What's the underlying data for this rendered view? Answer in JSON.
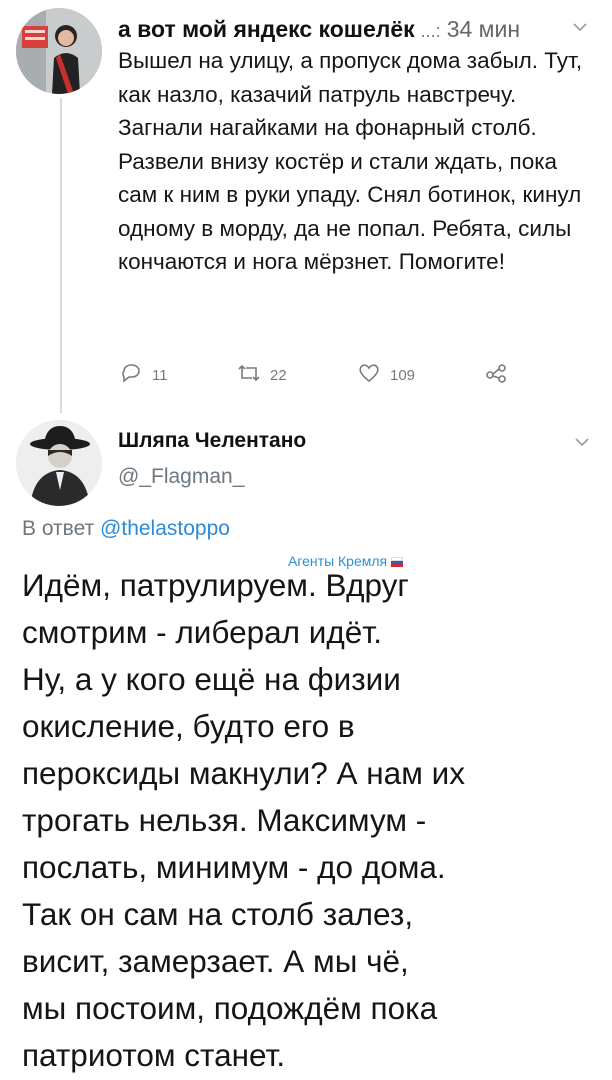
{
  "tweet1": {
    "author_name": "а вот мой яндекс кошелёк",
    "dots": "...:",
    "time": "34 мин",
    "text": "Вышел на улицу, а пропуск дома забыл. Тут, как назло, казачий патруль навстречу. Загнали нагайками на фонарный столб. Развели внизу костёр и стали ждать, пока сам к ним в руки упаду. Снял ботинок, кинул одному в морду, да не попал. Ребята, силы кончаются и нога мёрзнет. Помогите!",
    "reply_count": "11",
    "retweet_count": "22",
    "like_count": "109"
  },
  "tweet2": {
    "author_name": "Шляпа Челентано",
    "handle": "@_Flagman_",
    "reply_prefix": "В ответ",
    "reply_mention": "@thelastoppo",
    "badge_text": "Агенты Кремля",
    "lines": [
      "Идём, патрулируем. Вдруг",
      "смотрим - либерал идёт.",
      "Ну, а у кого ещё на физии",
      "окисление, будто его в",
      "пероксиды макнули? А нам их",
      "трогать нельзя. Максимум -",
      "послать, минимум - до дома.",
      "Так он сам на столб залез,",
      "висит, замерзает. А мы чё,",
      "мы постоим, подождём пока",
      "патриотом станет."
    ]
  },
  "icons": {
    "reply": "reply-icon",
    "retweet": "retweet-icon",
    "like": "heart-icon",
    "share": "share-icon",
    "menu": "chevron-down-icon"
  },
  "colors": {
    "link": "#2b8ad9",
    "muted": "#6c7780",
    "badge": "#2f8fd4"
  }
}
